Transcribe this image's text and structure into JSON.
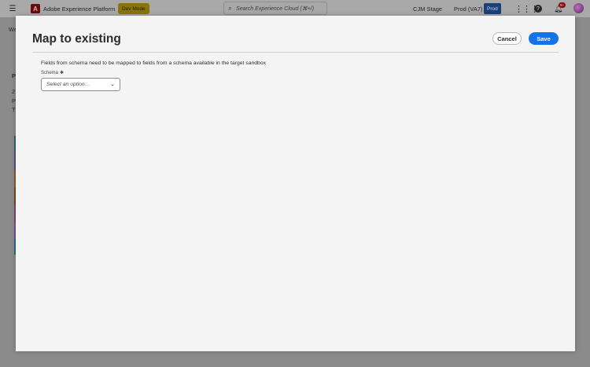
{
  "header": {
    "app_title": "Adobe Experience Platform",
    "dev_mode_label": "Dev Mode",
    "search_placeholder": "Search Experience Cloud (⌘+/)",
    "org_label": "CJM Stage",
    "sandbox_label": "Prod (VA7)",
    "sandbox_badge": "Prod",
    "notification_count": "9+",
    "icons": [
      "hamburger-icon",
      "adobe-logo",
      "search-icon",
      "apps-grid-icon",
      "help-icon",
      "bell-icon",
      "avatar"
    ]
  },
  "background": {
    "partial_texts": [
      "We",
      "P",
      "2",
      "P",
      "T"
    ]
  },
  "dialog": {
    "title": "Map to existing",
    "cancel_label": "Cancel",
    "save_label": "Save",
    "description": "Fields from schema need to be mapped to fields from a schema available in the target sandbox",
    "schema_label": "Schema",
    "required_marker": "✱",
    "schema_placeholder": "Select an option…"
  },
  "colors": {
    "accent": "#1473e6",
    "dev_badge": "#c8a800",
    "prod_badge": "#0d5fdc",
    "notification": "#d7373f"
  }
}
